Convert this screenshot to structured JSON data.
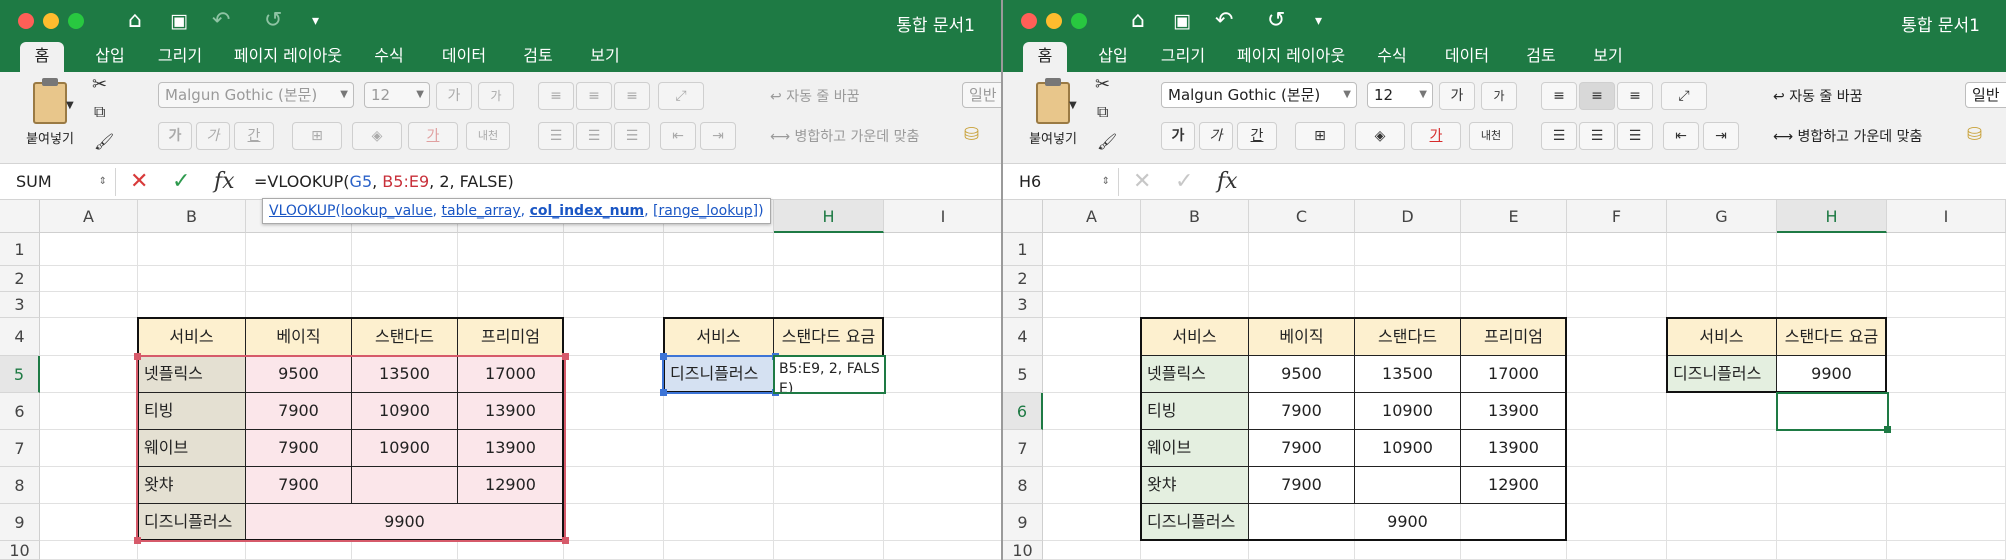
{
  "app": {
    "title": "통합 문서1",
    "ribbon_tabs": [
      "홈",
      "삽입",
      "그리기",
      "페이지 레이아웃",
      "수식",
      "데이터",
      "검토",
      "보기"
    ]
  },
  "ribbon": {
    "paste_label": "붙여넣기",
    "font_name": "Malgun Gothic (본문)",
    "font_size": "12",
    "grow_font": "가",
    "shrink_font": "가",
    "bold": "가",
    "italic": "가",
    "underline": "간",
    "font_color_glyph": "가",
    "phonetic": "내천",
    "wrap_text": "자동 줄 바꿈",
    "merge_center": "병합하고 가운데 맞춤",
    "number_format": "일반"
  },
  "columns": [
    "A",
    "B",
    "C",
    "D",
    "E",
    "F",
    "G",
    "H",
    "I"
  ],
  "rows": [
    "1",
    "2",
    "3",
    "4",
    "5",
    "6",
    "7",
    "8",
    "9",
    "10"
  ],
  "sheet": {
    "table_headers": [
      "서비스",
      "베이직",
      "스탠다드",
      "프리미엄"
    ],
    "table_rows": [
      [
        "넷플릭스",
        "9500",
        "13500",
        "17000"
      ],
      [
        "티빙",
        "7900",
        "10900",
        "13900"
      ],
      [
        "웨이브",
        "7900",
        "10900",
        "13900"
      ],
      [
        "왓챠",
        "7900",
        "",
        "12900"
      ]
    ],
    "merged_row": {
      "service": "디즈니플러스",
      "value": "9900"
    },
    "lookup_headers": [
      "서비스",
      "스탠다드 요금"
    ],
    "lookup_service": "디즈니플러스",
    "lookup_result": "9900",
    "editing_text": "B5:E9, 2, FALSE)"
  },
  "left": {
    "name_box": "SUM",
    "formula": {
      "prefix": "=VLOOKUP(",
      "ref1": "G5",
      "sep1": ", ",
      "ref2": "B5:E9",
      "suffix": ", 2, FALSE)"
    },
    "tooltip": {
      "fn": "VLOOKUP",
      "open": "(",
      "a1": "lookup_value",
      "c1": ", ",
      "a2": "table_array",
      "c2": ", ",
      "a3": "col_index_num",
      "c3": ", ",
      "a4": "[range_lookup]",
      "close": ")"
    }
  },
  "right": {
    "name_box": "H6"
  },
  "colors": {
    "accent": "#1e7a44",
    "header_fill": "#fdf0cf",
    "service_fill": "#e4efe0",
    "range_pink": "#fbe6ea",
    "ref_blue": "#3d74d6",
    "ref_red": "#d65a6a"
  }
}
